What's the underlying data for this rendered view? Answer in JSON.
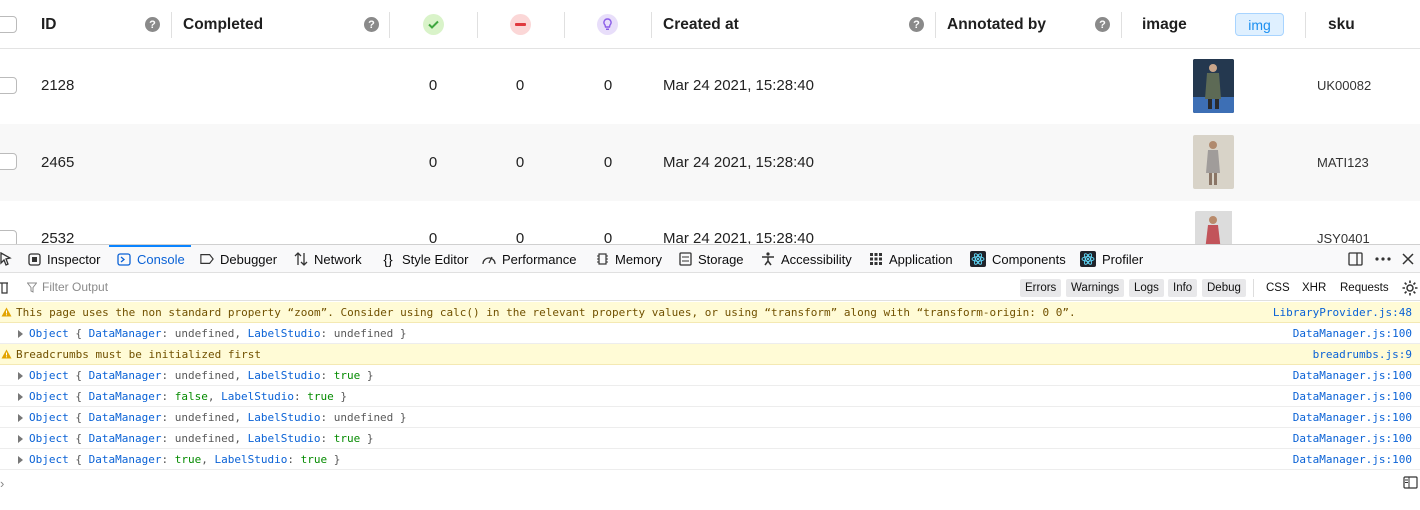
{
  "table": {
    "columns": {
      "id": "ID",
      "completed": "Completed",
      "created_at": "Created at",
      "annotated_by": "Annotated by",
      "image": "image",
      "img_badge": "img",
      "sku": "sku"
    },
    "help_glyph": "?",
    "rows": [
      {
        "id": "2128",
        "completed": "",
        "accepted": "0",
        "rejected": "0",
        "predictions": "0",
        "created_at": "Mar 24 2021, 15:28:40",
        "sku": "UK00082"
      },
      {
        "id": "2465",
        "completed": "",
        "accepted": "0",
        "rejected": "0",
        "predictions": "0",
        "created_at": "Mar 24 2021, 15:28:40",
        "sku": "MATI123"
      },
      {
        "id": "2532",
        "completed": "",
        "accepted": "0",
        "rejected": "0",
        "predictions": "0",
        "created_at": "Mar 24 2021, 15:28:40",
        "sku": "JSY0401"
      }
    ]
  },
  "devtools": {
    "tabs": [
      {
        "label": "Inspector",
        "icon": "inspector-icon"
      },
      {
        "label": "Console",
        "icon": "console-icon",
        "active": true
      },
      {
        "label": "Debugger",
        "icon": "debugger-icon"
      },
      {
        "label": "Network",
        "icon": "network-icon"
      },
      {
        "label": "Style Editor",
        "icon": "style-editor-icon"
      },
      {
        "label": "Performance",
        "icon": "performance-icon"
      },
      {
        "label": "Memory",
        "icon": "memory-icon"
      },
      {
        "label": "Storage",
        "icon": "storage-icon"
      },
      {
        "label": "Accessibility",
        "icon": "accessibility-icon"
      },
      {
        "label": "Application",
        "icon": "application-icon"
      },
      {
        "label": "Components",
        "icon": "react-icon"
      },
      {
        "label": "Profiler",
        "icon": "react-icon"
      }
    ],
    "filter_placeholder": "Filter Output",
    "filter_buttons": [
      "Errors",
      "Warnings",
      "Logs",
      "Info",
      "Debug"
    ],
    "filter_toggles": [
      "CSS",
      "XHR",
      "Requests"
    ],
    "logs": [
      {
        "type": "warn",
        "text": "This page uses the non standard property “zoom”. Consider using calc() in the relevant property values, or using “transform” along with “transform-origin: 0 0”.",
        "source": "LibraryProvider.js:48"
      },
      {
        "type": "object",
        "dm": "undefined",
        "ls": "undefined",
        "source": "DataManager.js:100"
      },
      {
        "type": "warn",
        "text": "Breadcrumbs must be initialized first",
        "source": "breadrumbs.js:9"
      },
      {
        "type": "object",
        "dm": "undefined",
        "ls": "true",
        "source": "DataManager.js:100"
      },
      {
        "type": "object",
        "dm": "false",
        "ls": "true",
        "source": "DataManager.js:100"
      },
      {
        "type": "object",
        "dm": "undefined",
        "ls": "undefined",
        "source": "DataManager.js:100"
      },
      {
        "type": "object",
        "dm": "undefined",
        "ls": "true",
        "source": "DataManager.js:100"
      },
      {
        "type": "object",
        "dm": "true",
        "ls": "true",
        "source": "DataManager.js:100"
      }
    ],
    "object_label": "Object",
    "key_dm": "DataManager",
    "key_ls": "LabelStudio",
    "colors": {
      "accent": "#0a84ff",
      "warn_bg": "#fffbd6",
      "link": "#0a62d6"
    }
  }
}
